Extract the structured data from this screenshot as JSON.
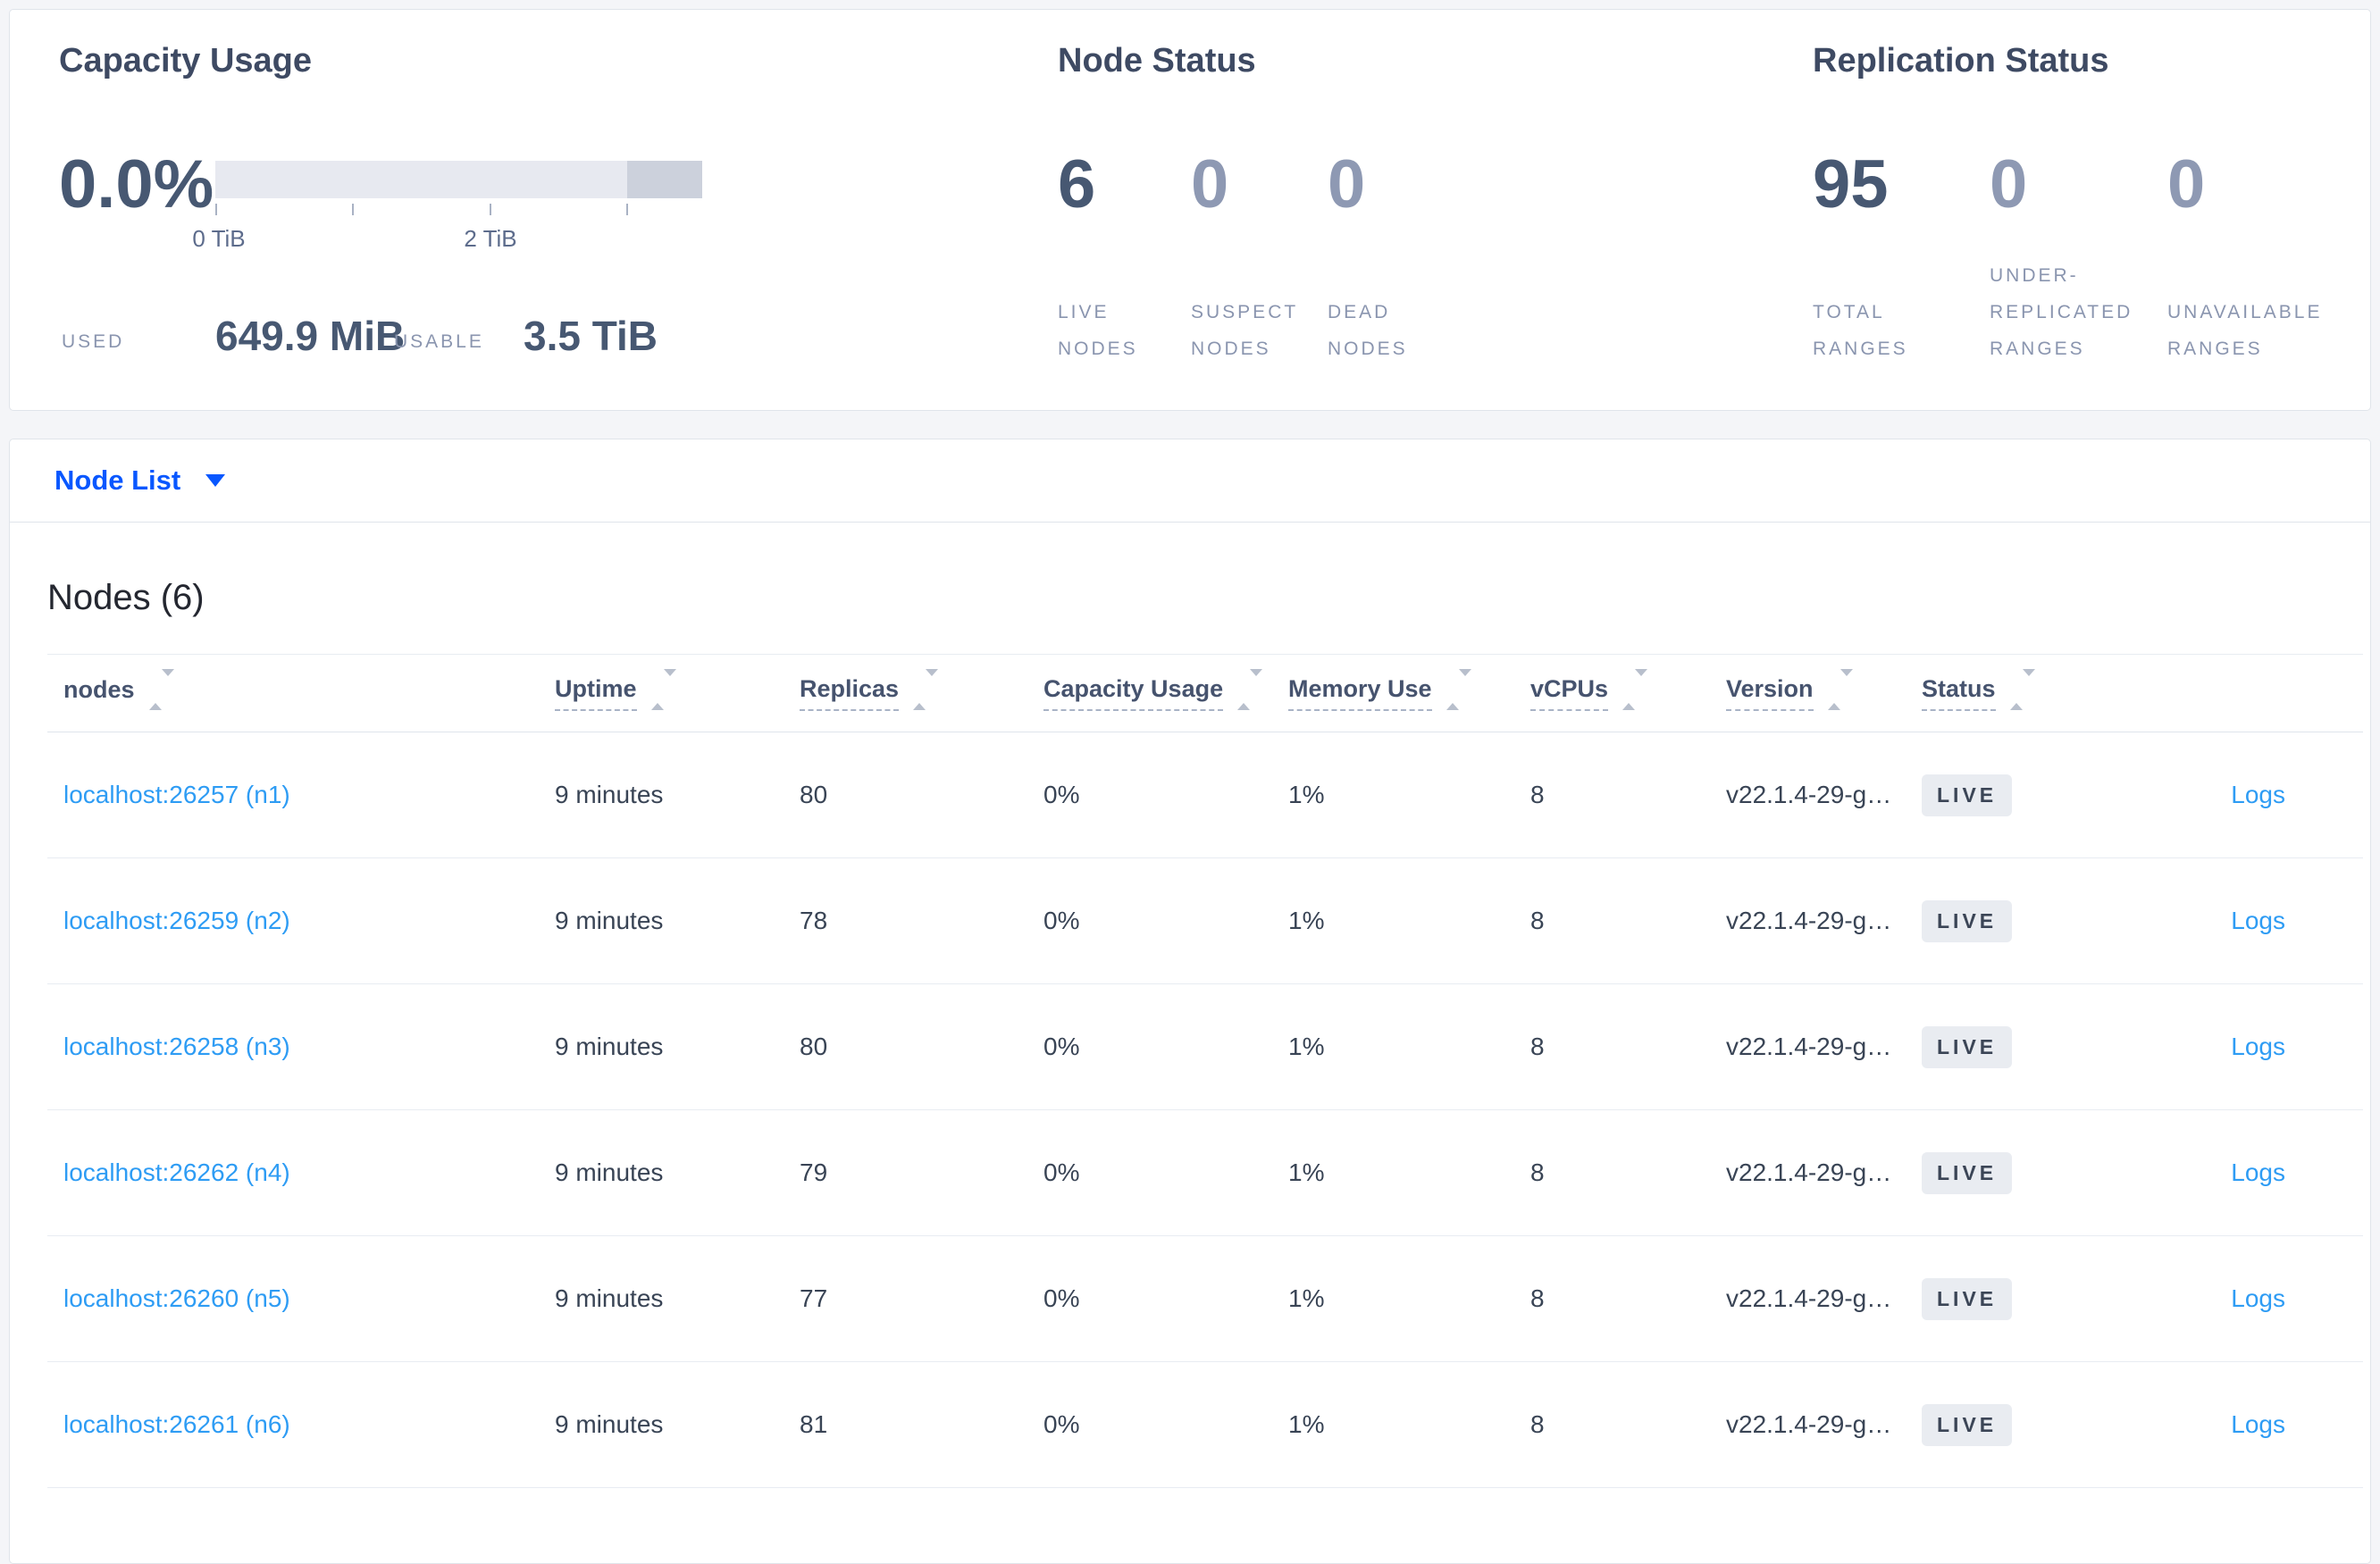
{
  "summary": {
    "capacity": {
      "title": "Capacity Usage",
      "percent": "0.0%",
      "axis_ticks": [
        "0 TiB",
        "2 TiB"
      ],
      "used_label": "USED",
      "used_value": "649.9 MiB",
      "usable_label": "USABLE",
      "usable_value": "3.5 TiB"
    },
    "node_status": {
      "title": "Node Status",
      "stats": [
        {
          "value": "6",
          "label": "LIVE NODES"
        },
        {
          "value": "0",
          "label": "SUSPECT NODES"
        },
        {
          "value": "0",
          "label": "DEAD NODES"
        }
      ]
    },
    "replication_status": {
      "title": "Replication Status",
      "stats": [
        {
          "value": "95",
          "label": "TOTAL RANGES"
        },
        {
          "value": "0",
          "label": "UNDER-REPLICATED RANGES"
        },
        {
          "value": "0",
          "label": "UNAVAILABLE RANGES"
        }
      ]
    }
  },
  "view_selector": {
    "label": "Node List",
    "caret_icon": "triangle-down"
  },
  "nodes_panel": {
    "title": "Nodes (6)",
    "sort_icon": "up-down-triangles",
    "columns": [
      {
        "key": "node",
        "label": "nodes",
        "hint": false
      },
      {
        "key": "uptime",
        "label": "Uptime",
        "hint": true
      },
      {
        "key": "replicas",
        "label": "Replicas",
        "hint": true
      },
      {
        "key": "capacity",
        "label": "Capacity Usage",
        "hint": true
      },
      {
        "key": "memory",
        "label": "Memory Use",
        "hint": true
      },
      {
        "key": "vcpus",
        "label": "vCPUs",
        "hint": true
      },
      {
        "key": "version",
        "label": "Version",
        "hint": true
      },
      {
        "key": "status",
        "label": "Status",
        "hint": true
      }
    ],
    "rows": [
      {
        "node": "localhost:26257 (n1)",
        "uptime": "9 minutes",
        "replicas": "80",
        "capacity": "0%",
        "memory": "1%",
        "vcpus": "8",
        "version": "v22.1.4-29-g…",
        "status": "LIVE",
        "logs": "Logs"
      },
      {
        "node": "localhost:26259 (n2)",
        "uptime": "9 minutes",
        "replicas": "78",
        "capacity": "0%",
        "memory": "1%",
        "vcpus": "8",
        "version": "v22.1.4-29-g…",
        "status": "LIVE",
        "logs": "Logs"
      },
      {
        "node": "localhost:26258 (n3)",
        "uptime": "9 minutes",
        "replicas": "80",
        "capacity": "0%",
        "memory": "1%",
        "vcpus": "8",
        "version": "v22.1.4-29-g…",
        "status": "LIVE",
        "logs": "Logs"
      },
      {
        "node": "localhost:26262 (n4)",
        "uptime": "9 minutes",
        "replicas": "79",
        "capacity": "0%",
        "memory": "1%",
        "vcpus": "8",
        "version": "v22.1.4-29-g…",
        "status": "LIVE",
        "logs": "Logs"
      },
      {
        "node": "localhost:26260 (n5)",
        "uptime": "9 minutes",
        "replicas": "77",
        "capacity": "0%",
        "memory": "1%",
        "vcpus": "8",
        "version": "v22.1.4-29-g…",
        "status": "LIVE",
        "logs": "Logs"
      },
      {
        "node": "localhost:26261 (n6)",
        "uptime": "9 minutes",
        "replicas": "81",
        "capacity": "0%",
        "memory": "1%",
        "vcpus": "8",
        "version": "v22.1.4-29-g…",
        "status": "LIVE",
        "logs": "Logs"
      }
    ]
  }
}
